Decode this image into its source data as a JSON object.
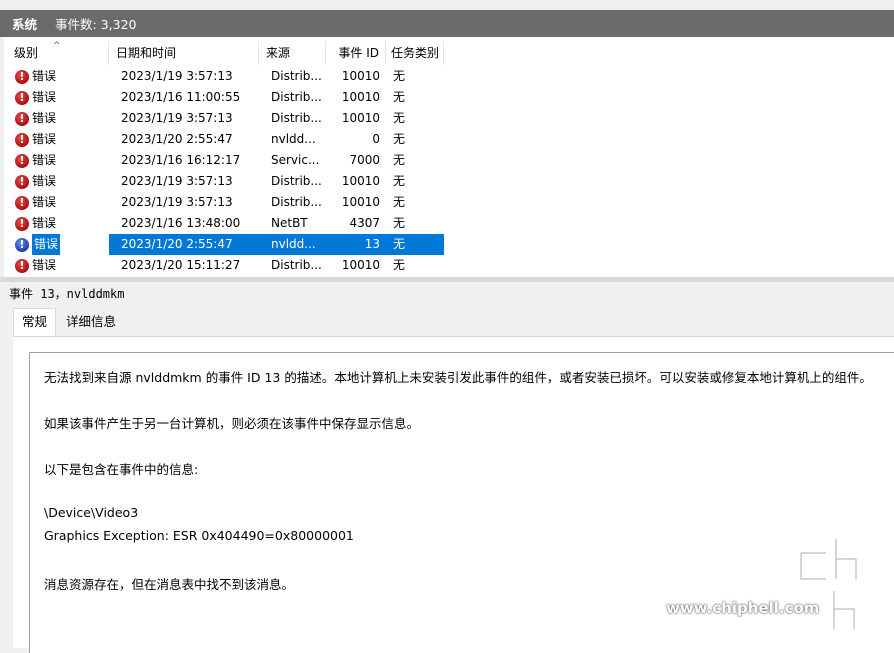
{
  "header": {
    "log_name": "系统",
    "event_count_label": "事件数: 3,320"
  },
  "columns": [
    {
      "key": "level",
      "label": "级别"
    },
    {
      "key": "date",
      "label": "日期和时间"
    },
    {
      "key": "source",
      "label": "来源"
    },
    {
      "key": "id",
      "label": "事件 ID"
    },
    {
      "key": "task",
      "label": "任务类别"
    }
  ],
  "rows": [
    {
      "level": "错误",
      "date": "2023/1/19 3:57:13",
      "source": "Distrib...",
      "id": "10010",
      "task": "无",
      "selected": false
    },
    {
      "level": "错误",
      "date": "2023/1/16 11:00:55",
      "source": "Distrib...",
      "id": "10010",
      "task": "无",
      "selected": false
    },
    {
      "level": "错误",
      "date": "2023/1/19 3:57:13",
      "source": "Distrib...",
      "id": "10010",
      "task": "无",
      "selected": false
    },
    {
      "level": "错误",
      "date": "2023/1/20 2:55:47",
      "source": "nvldd...",
      "id": "0",
      "task": "无",
      "selected": false
    },
    {
      "level": "错误",
      "date": "2023/1/16 16:12:17",
      "source": "Servic...",
      "id": "7000",
      "task": "无",
      "selected": false
    },
    {
      "level": "错误",
      "date": "2023/1/19 3:57:13",
      "source": "Distrib...",
      "id": "10010",
      "task": "无",
      "selected": false
    },
    {
      "level": "错误",
      "date": "2023/1/19 3:57:13",
      "source": "Distrib...",
      "id": "10010",
      "task": "无",
      "selected": false
    },
    {
      "level": "错误",
      "date": "2023/1/16 13:48:00",
      "source": "NetBT",
      "id": "4307",
      "task": "无",
      "selected": false
    },
    {
      "level": "错误",
      "date": "2023/1/20 2:55:47",
      "source": "nvldd...",
      "id": "13",
      "task": "无",
      "selected": true
    },
    {
      "level": "错误",
      "date": "2023/1/20 15:11:27",
      "source": "Distrib...",
      "id": "10010",
      "task": "无",
      "selected": false
    }
  ],
  "detail": {
    "title": "事件 13，nvlddmkm",
    "tabs": [
      {
        "label": "常规",
        "active": true
      },
      {
        "label": "详细信息",
        "active": false
      }
    ],
    "message_lines": [
      "无法找到来自源 nvlddmkm 的事件 ID 13 的描述。本地计算机上未安装引发此事件的组件，或者安装已损坏。可以安装或修复本地计算机上的组件。",
      "如果该事件产生于另一台计算机，则必须在该事件中保存显示信息。",
      "以下是包含在事件中的信息:",
      "\\Device\\Video3",
      "Graphics Exception: ESR 0x404490=0x80000001",
      "消息资源存在，但在消息表中找不到该消息。"
    ]
  },
  "watermark": {
    "text": "www.chiphell.com",
    "logo_text": "chip hell"
  },
  "icons": {
    "error": "error-icon"
  },
  "colors": {
    "titlebar": "#6b6b6b",
    "selection": "#0078d7",
    "error": "#c0181a"
  }
}
